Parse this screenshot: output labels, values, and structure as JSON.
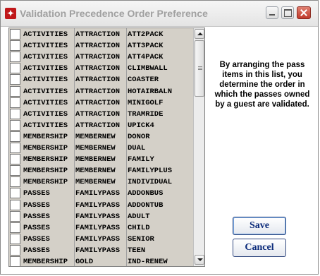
{
  "window": {
    "title": "Validation Precedence Order Preference"
  },
  "list": {
    "rows": [
      [
        "ACTIVITIES",
        "ATTRACTION",
        "ATT2PACK"
      ],
      [
        "ACTIVITIES",
        "ATTRACTION",
        "ATT3PACK"
      ],
      [
        "ACTIVITIES",
        "ATTRACTION",
        "ATT4PACK"
      ],
      [
        "ACTIVITIES",
        "ATTRACTION",
        "CLIMBWALL"
      ],
      [
        "ACTIVITIES",
        "ATTRACTION",
        "COASTER"
      ],
      [
        "ACTIVITIES",
        "ATTRACTION",
        "HOTAIRBALN"
      ],
      [
        "ACTIVITIES",
        "ATTRACTION",
        "MINIGOLF"
      ],
      [
        "ACTIVITIES",
        "ATTRACTION",
        "TRAMRIDE"
      ],
      [
        "ACTIVITIES",
        "ATTRACTION",
        "UPICK4"
      ],
      [
        "MEMBERSHIP",
        "MEMBERNEW",
        "DONOR"
      ],
      [
        "MEMBERSHIP",
        "MEMBERNEW",
        "DUAL"
      ],
      [
        "MEMBERSHIP",
        "MEMBERNEW",
        "FAMILY"
      ],
      [
        "MEMBERSHIP",
        "MEMBERNEW",
        "FAMILYPLUS"
      ],
      [
        "MEMBERSHIP",
        "MEMBERNEW",
        "INDIVIDUAL"
      ],
      [
        "PASSES",
        "FAMILYPASS",
        "ADDONBUS"
      ],
      [
        "PASSES",
        "FAMILYPASS",
        "ADDONTUB"
      ],
      [
        "PASSES",
        "FAMILYPASS",
        "ADULT"
      ],
      [
        "PASSES",
        "FAMILYPASS",
        "CHILD"
      ],
      [
        "PASSES",
        "FAMILYPASS",
        "SENIOR"
      ],
      [
        "PASSES",
        "FAMILYPASS",
        "TEEN"
      ],
      [
        "MEMBERSHIP",
        "GOLD",
        "IND-RENEW"
      ]
    ]
  },
  "info": {
    "text": "By arranging the pass items in this list, you determine the order in which the passes owned by a guest are validated."
  },
  "buttons": {
    "save": "Save",
    "cancel": "Cancel"
  },
  "icons": {
    "app": "app-logo-icon",
    "minimize": "minimize-icon",
    "maximize": "maximize-icon",
    "close": "close-icon",
    "scroll_up": "chevron-up-icon",
    "scroll_down": "chevron-down-icon"
  },
  "colors": {
    "list_bg": "#d4d0c8",
    "button_text": "#0a2a7a",
    "close_button": "#c0392b"
  }
}
